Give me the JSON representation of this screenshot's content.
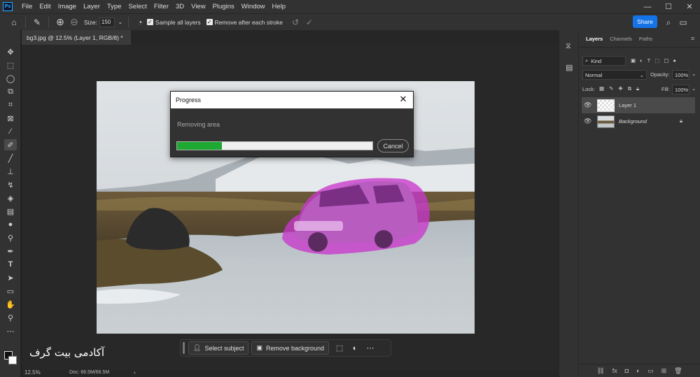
{
  "menubar": {
    "logo": "Ps",
    "items": [
      "File",
      "Edit",
      "Image",
      "Layer",
      "Type",
      "Select",
      "Filter",
      "3D",
      "View",
      "Plugins",
      "Window",
      "Help"
    ],
    "window_controls": [
      "—",
      "☐",
      "✕"
    ]
  },
  "options": {
    "size_label": "Size:",
    "size_value": "150",
    "sample_all_layers": "Sample all layers",
    "remove_after_each_stroke": "Remove after each stroke",
    "share": "Share"
  },
  "document": {
    "tab_title": "bg3.jpg @ 12.5% (Layer 1, RGB/8) *",
    "zoom": "12.5%",
    "doc_info": "Doc: 66.5M/66.5M"
  },
  "progress": {
    "title": "Progress",
    "message": "Removing area",
    "percent": 0.23,
    "cancel": "Cancel"
  },
  "taskbar": {
    "select_subject": "Select subject",
    "remove_background": "Remove background"
  },
  "watermark": "آکادمی بیت گرف",
  "layers_panel": {
    "tabs": [
      "Layers",
      "Channels",
      "Paths"
    ],
    "filter_kind": "Kind",
    "blend_mode": "Normal",
    "opacity_label": "Opacity:",
    "opacity_value": "100%",
    "lock_label": "Lock:",
    "fill_label": "Fill:",
    "fill_value": "100%",
    "layers": [
      {
        "name": "Layer 1"
      },
      {
        "name": "Background"
      }
    ]
  },
  "colors": {
    "accent": "#1473e6",
    "progress": "#1eaa32",
    "mask": "#d040d8"
  }
}
